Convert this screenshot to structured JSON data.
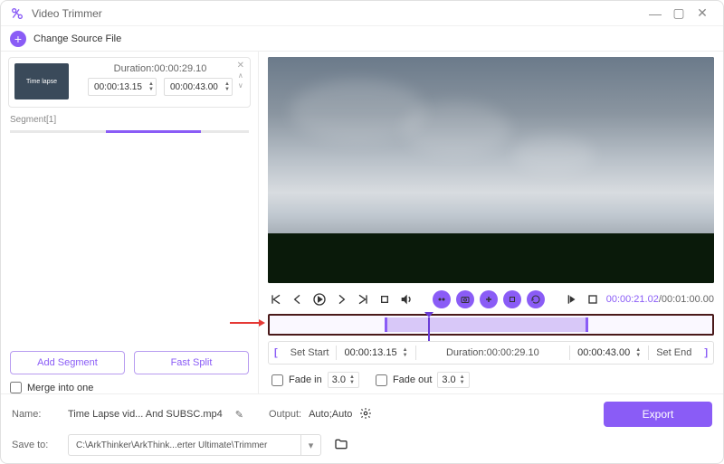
{
  "window": {
    "title": "Video Trimmer"
  },
  "toolbar": {
    "change_source": "Change Source File"
  },
  "segment": {
    "label": "Segment[1]",
    "duration_label": "Duration:00:00:29.10",
    "start": "00:00:13.15",
    "end": "00:00:43.00"
  },
  "buttons": {
    "add_segment": "Add Segment",
    "fast_split": "Fast Split",
    "merge": "Merge into one",
    "export": "Export"
  },
  "playback": {
    "current": "00:00:21.02",
    "total": "/00:01:00.00"
  },
  "setbar": {
    "set_start": "Set Start",
    "start_time": "00:00:13.15",
    "duration": "Duration:00:00:29.10",
    "end_time": "00:00:43.00",
    "set_end": "Set End"
  },
  "fade": {
    "in_label": "Fade in",
    "in_val": "3.0",
    "out_label": "Fade out",
    "out_val": "3.0"
  },
  "footer": {
    "name_label": "Name:",
    "name_value": "Time Lapse vid... And SUBSC.mp4",
    "output_label": "Output:",
    "output_value": "Auto;Auto",
    "save_label": "Save to:",
    "save_path": "C:\\ArkThinker\\ArkThink...erter Ultimate\\Trimmer"
  }
}
